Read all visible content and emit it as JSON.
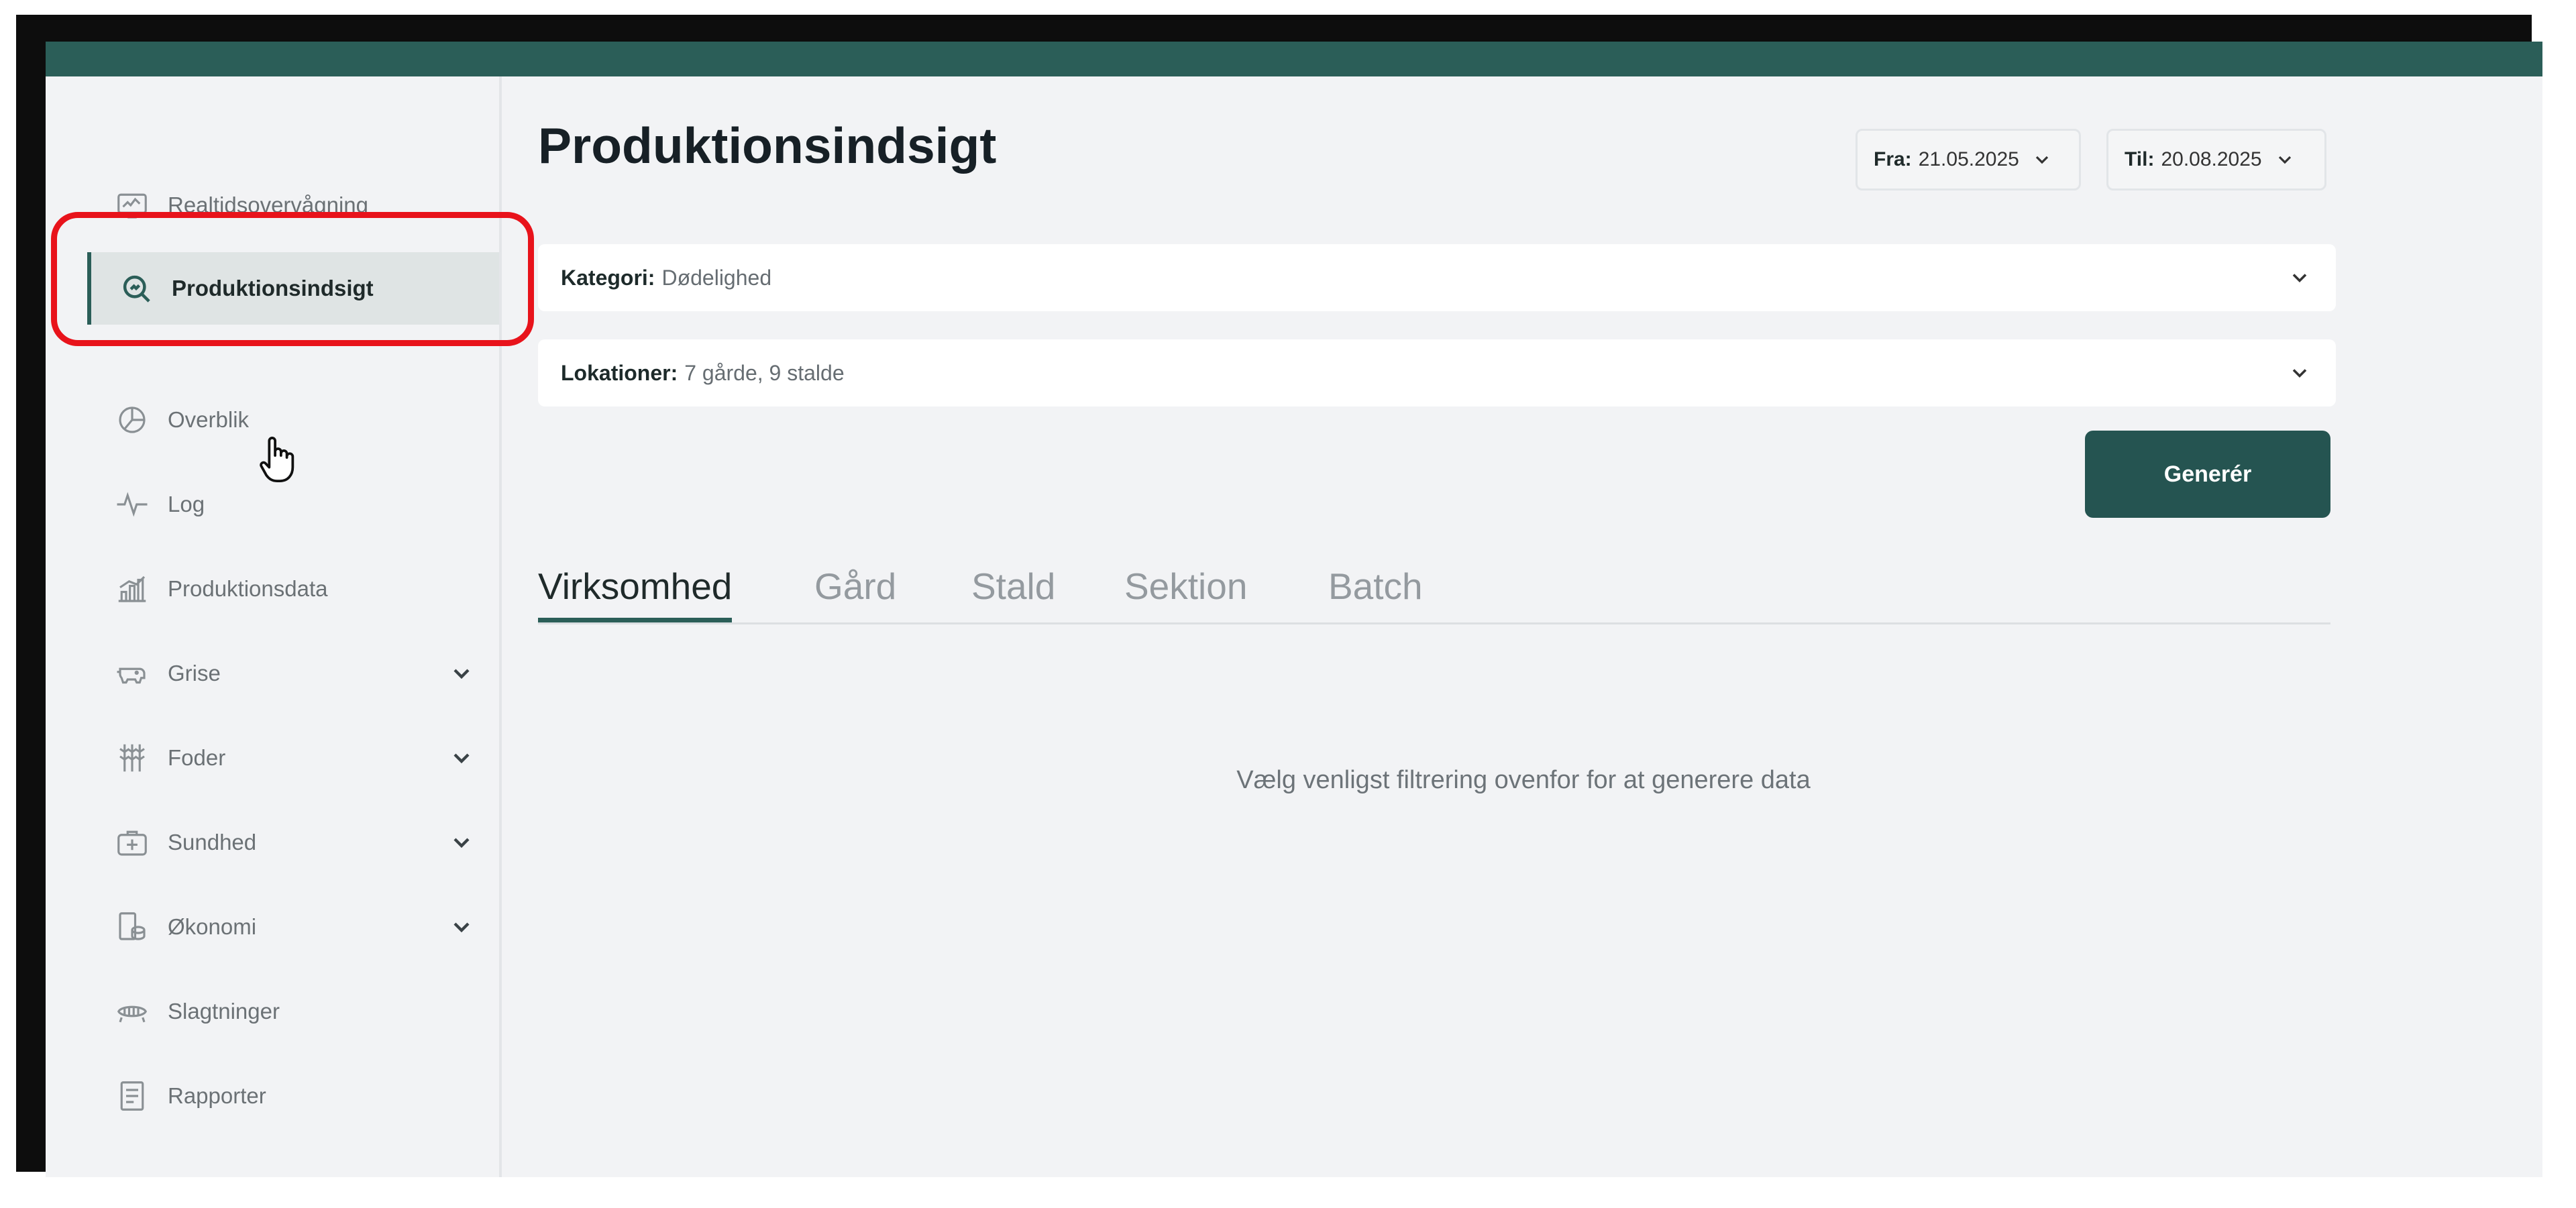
{
  "sidebar": {
    "items": [
      {
        "label": "Realtidsovervågning",
        "icon": "monitor-icon",
        "active": false,
        "expandable": false
      },
      {
        "label": "Produktionsindsigt",
        "icon": "search-chart-icon",
        "active": true,
        "expandable": false
      },
      {
        "label": "Overblik",
        "icon": "pie-chart-icon",
        "active": false,
        "expandable": false
      },
      {
        "label": "Log",
        "icon": "activity-icon",
        "active": false,
        "expandable": false
      },
      {
        "label": "Produktionsdata",
        "icon": "bar-chart-icon",
        "active": false,
        "expandable": false
      },
      {
        "label": "Grise",
        "icon": "pig-icon",
        "active": false,
        "expandable": true
      },
      {
        "label": "Foder",
        "icon": "wheat-icon",
        "active": false,
        "expandable": true
      },
      {
        "label": "Sundhed",
        "icon": "health-icon",
        "active": false,
        "expandable": true
      },
      {
        "label": "Økonomi",
        "icon": "coins-icon",
        "active": false,
        "expandable": true
      },
      {
        "label": "Slagtninger",
        "icon": "carcass-icon",
        "active": false,
        "expandable": false
      },
      {
        "label": "Rapporter",
        "icon": "report-icon",
        "active": false,
        "expandable": false
      }
    ]
  },
  "header": {
    "title": "Produktionsindsigt",
    "from": {
      "label": "Fra:",
      "value": "21.05.2025"
    },
    "to": {
      "label": "Til:",
      "value": "20.08.2025"
    }
  },
  "filters": {
    "kategori": {
      "label": "Kategori:",
      "value": "Dødelighed"
    },
    "lokationer": {
      "label": "Lokationer:",
      "value": "7 gårde, 9 stalde"
    }
  },
  "generate_label": "Generér",
  "tabs": [
    {
      "label": "Virksomhed",
      "active": true
    },
    {
      "label": "Gård",
      "active": false
    },
    {
      "label": "Stald",
      "active": false
    },
    {
      "label": "Sektion",
      "active": false
    },
    {
      "label": "Batch",
      "active": false
    }
  ],
  "empty_message": "Vælg venligst filtrering ovenfor for at generere data",
  "colors": {
    "brand": "#2b5e58",
    "button": "#255451",
    "highlight": "#e8131b",
    "background": "#f2f3f5"
  }
}
